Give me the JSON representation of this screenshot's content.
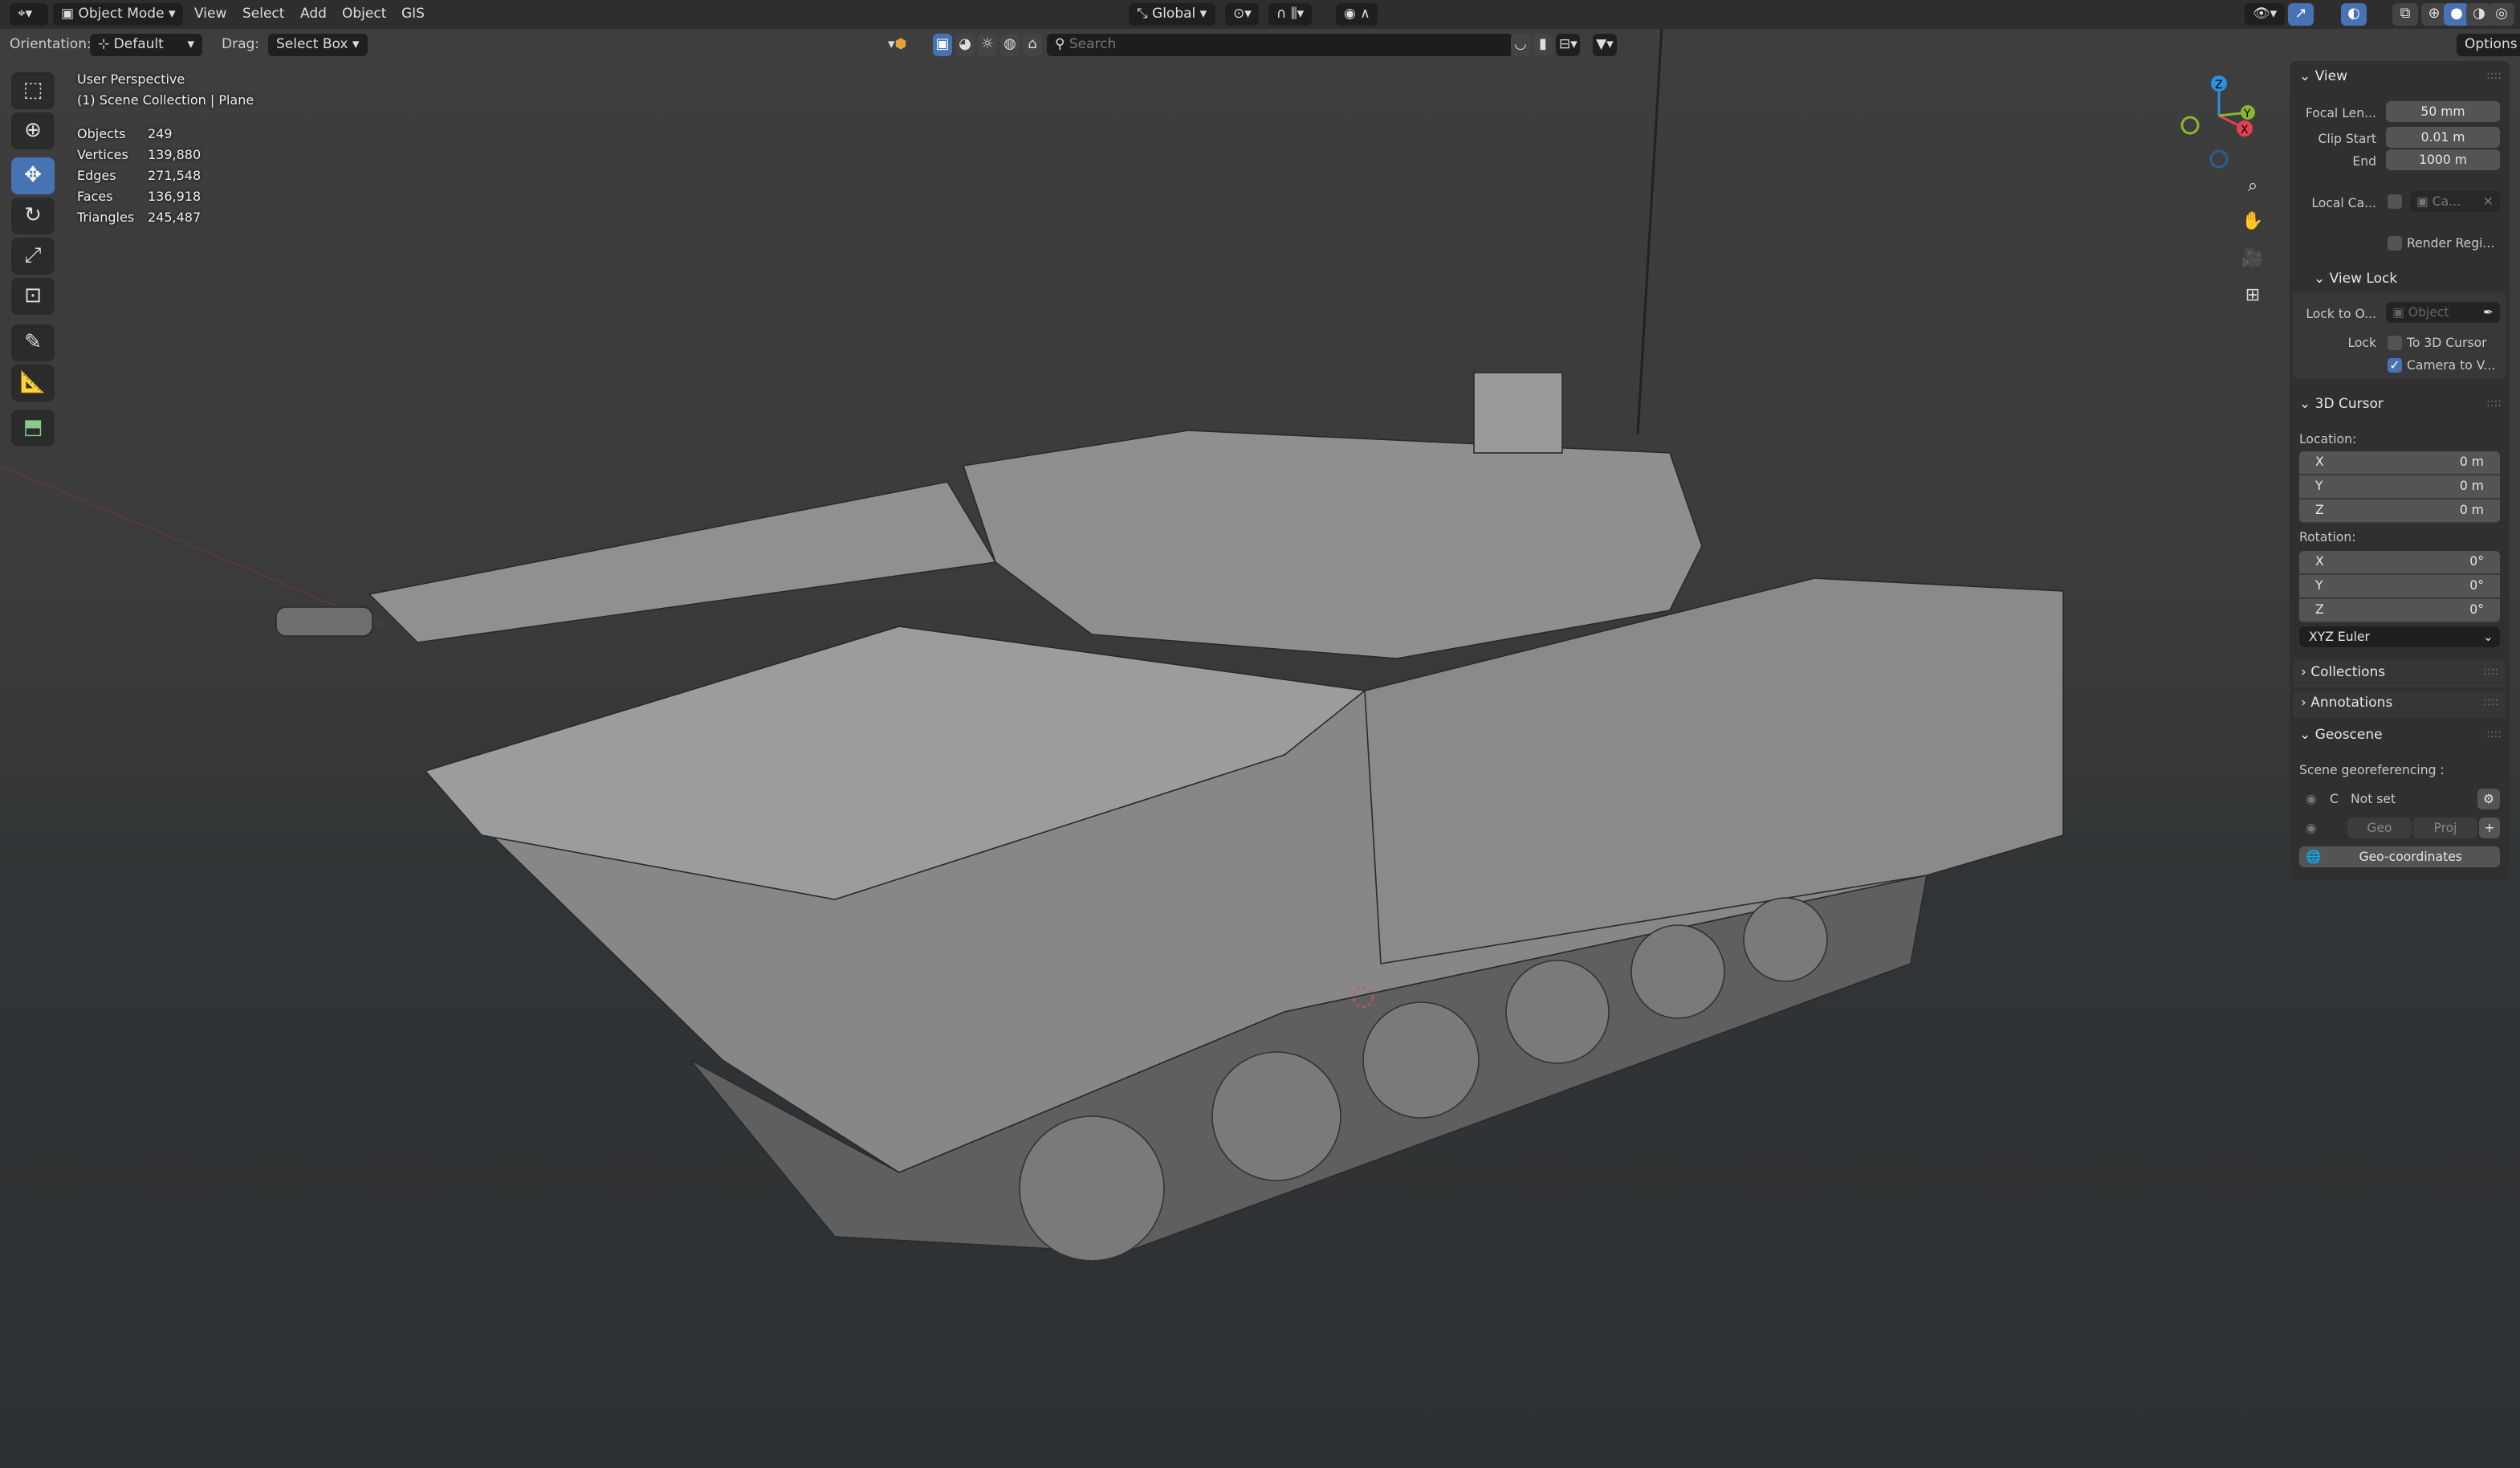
{
  "header": {
    "mode": "Object Mode",
    "menus": [
      "View",
      "Select",
      "Add",
      "Object",
      "GIS"
    ],
    "transform_orientation": "Global",
    "search_placeholder": "Search",
    "options": "Options"
  },
  "tool_settings": {
    "orientation_label": "Orientation:",
    "orientation_value": "Default",
    "drag_label": "Drag:",
    "drag_value": "Select Box"
  },
  "overlay": {
    "view_name": "User Perspective",
    "collection": "(1) Scene Collection | Plane",
    "stats": [
      {
        "label": "Objects",
        "value": "249"
      },
      {
        "label": "Vertices",
        "value": "139,880"
      },
      {
        "label": "Edges",
        "value": "271,548"
      },
      {
        "label": "Faces",
        "value": "136,918"
      },
      {
        "label": "Triangles",
        "value": "245,487"
      }
    ]
  },
  "toolbar": {
    "tools": [
      "select-box",
      "cursor",
      "move",
      "rotate",
      "scale",
      "transform",
      "annotate",
      "measure",
      "add-cube"
    ],
    "active": "move"
  },
  "gizmo": {
    "x": "X",
    "y": "Y",
    "z": "Z",
    "colors": {
      "x": "#e0434f",
      "y": "#8ab631",
      "z": "#2c8fe0"
    }
  },
  "panel": {
    "view": {
      "title": "View",
      "focal_label": "Focal Len...",
      "focal": "50 mm",
      "clip_start_label": "Clip Start",
      "clip_start": "0.01 m",
      "end_label": "End",
      "end": "1000 m",
      "local_cam_label": "Local Ca...",
      "local_cam_value": "Ca...",
      "render_region": "Render Regi...",
      "view_lock": {
        "title": "View Lock",
        "lock_to_label": "Lock to O...",
        "lock_to_placeholder": "Object",
        "lock_label": "Lock",
        "to_cursor": "To 3D Cursor",
        "camera_to_view": "Camera to V...",
        "camera_to_view_checked": true,
        "to_cursor_checked": false
      }
    },
    "cursor": {
      "title": "3D Cursor",
      "location_label": "Location:",
      "location": [
        {
          "axis": "X",
          "value": "0 m"
        },
        {
          "axis": "Y",
          "value": "0 m"
        },
        {
          "axis": "Z",
          "value": "0 m"
        }
      ],
      "rotation_label": "Rotation:",
      "rotation": [
        {
          "axis": "X",
          "value": "0°"
        },
        {
          "axis": "Y",
          "value": "0°"
        },
        {
          "axis": "Z",
          "value": "0°"
        }
      ],
      "rotation_mode": "XYZ Euler"
    },
    "collections": "Collections",
    "annotations": "Annotations",
    "geoscene": {
      "title": "Geoscene",
      "georef_label": "Scene georeferencing :",
      "c": "C",
      "status": "Not set",
      "geo": "Geo",
      "proj": "Proj",
      "geo_coords": "Geo-coordinates"
    }
  },
  "accent": "#4772b3"
}
